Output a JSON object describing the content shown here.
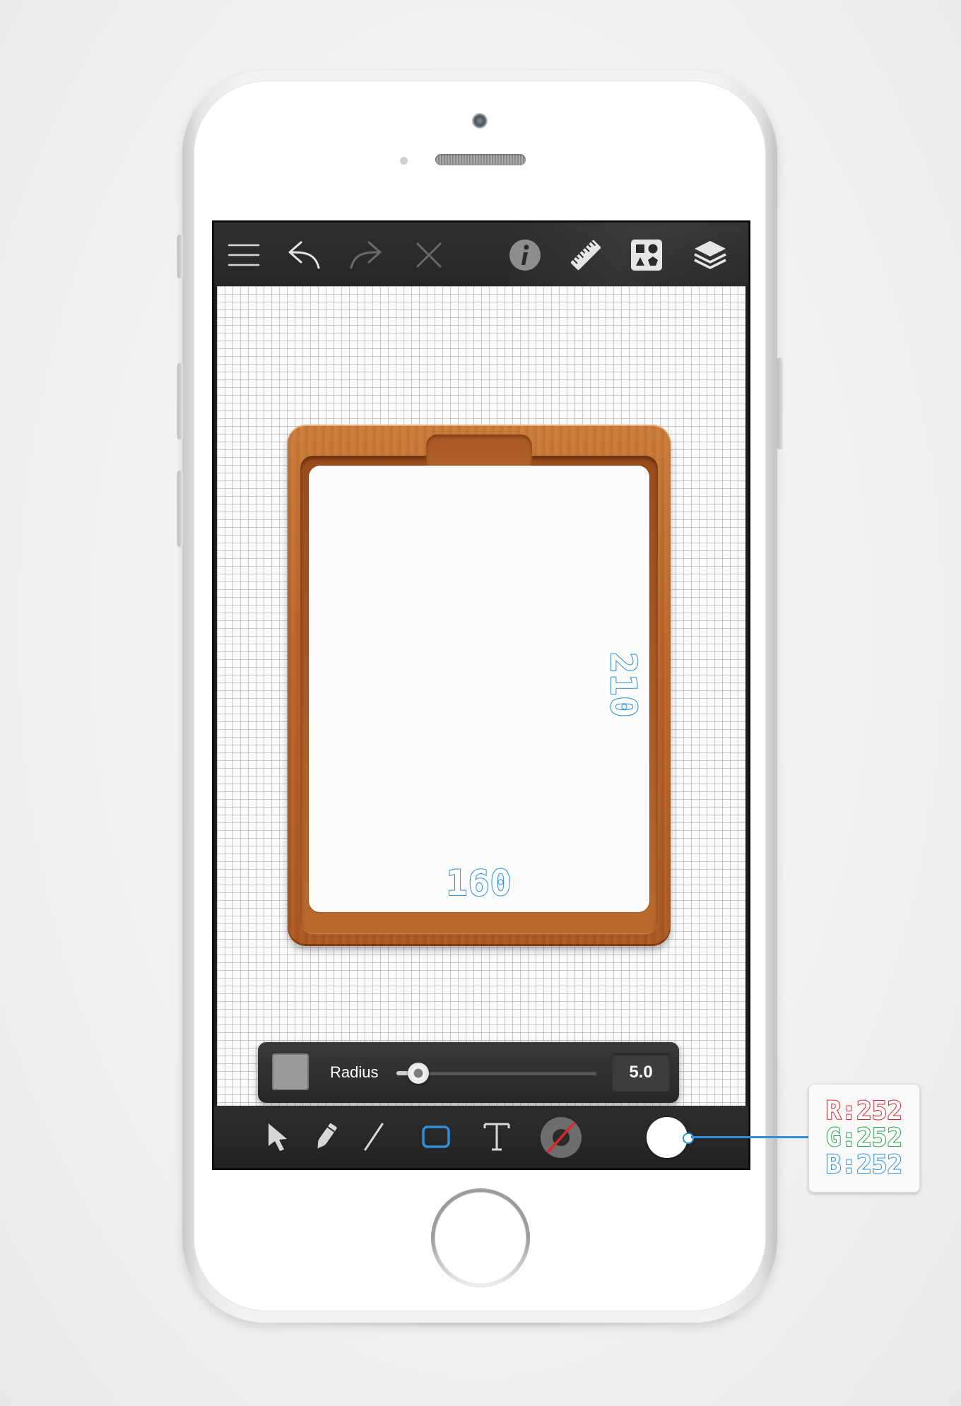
{
  "toolbar_top": {
    "icons": [
      "menu-icon",
      "undo-icon",
      "redo-icon",
      "close-icon",
      "info-icon",
      "ruler-icon",
      "shapes-icon",
      "layers-icon"
    ]
  },
  "canvas": {
    "dimension_width": "160",
    "dimension_height": "210"
  },
  "radius_panel": {
    "label": "Radius",
    "value": "5.0",
    "slider_fraction": 0.11,
    "swatch_color": "#9a9a9a"
  },
  "toolbar_bottom": {
    "icons": [
      "select-arrow-icon",
      "pencil-icon",
      "line-icon",
      "rectangle-icon",
      "text-icon",
      "stroke-color-icon",
      "fill-color-icon"
    ],
    "active_tool": "rectangle-icon",
    "accent_color": "#2f8fd8"
  },
  "color_readout": {
    "r_label": "R:",
    "r_value": "252",
    "g_label": "G:",
    "g_value": "252",
    "b_label": "B:",
    "b_value": "252"
  }
}
